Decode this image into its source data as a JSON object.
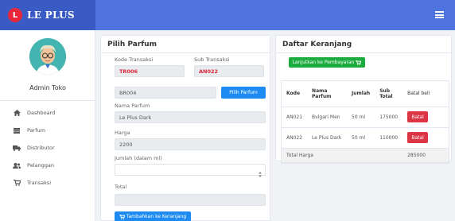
{
  "brand": {
    "logo_letter": "L",
    "name": "LE PLUS"
  },
  "sidebar": {
    "admin_name": "Admin Toko",
    "items": [
      {
        "label": "Dashboard",
        "icon": "home-icon"
      },
      {
        "label": "Parfum",
        "icon": "list-icon"
      },
      {
        "label": "Distributor",
        "icon": "truck-icon"
      },
      {
        "label": "Pelanggan",
        "icon": "users-icon"
      },
      {
        "label": "Transaksi",
        "icon": "cart-icon"
      }
    ]
  },
  "form": {
    "title": "Pilih Parfum",
    "kode_transaksi_label": "Kode Transaksi",
    "kode_transaksi_value": "TR006",
    "sub_transaksi_label": "Sub Transaksi",
    "sub_transaksi_value": "AN022",
    "parfum_code_value": "BR004",
    "pilih_button": "Pilih Parfum",
    "nama_label": "Nama Parfum",
    "nama_value": "Le Plus Dark",
    "harga_label": "Harga",
    "harga_value": "2200",
    "jumlah_label": "Jumlah (dalam ml)",
    "jumlah_value": "",
    "total_label": "Total",
    "total_value": "",
    "add_button": "Tambahkan ke Keranjang"
  },
  "cart": {
    "title": "Daftar Keranjang",
    "checkout_button": "Lanjutkan ke Pembayaran",
    "headers": [
      "Kode",
      "Nama Parfum",
      "Jumlah",
      "Sub Total",
      "Batal beli"
    ],
    "rows": [
      {
        "kode": "AN021",
        "nama": "Bvlgari Men",
        "jumlah": "50 ml",
        "subtotal": "175000",
        "action": "Batal"
      },
      {
        "kode": "AN022",
        "nama": "Le Plus Dark",
        "jumlah": "50 ml",
        "subtotal": "110000",
        "action": "Batal"
      }
    ],
    "total_label": "Total Harga",
    "total_value": "285000"
  },
  "colors": {
    "topbar": "#4e73df",
    "primary": "#1d8bf1",
    "success": "#1cab3f",
    "danger": "#dc3545",
    "code_red": "#d9283a"
  }
}
